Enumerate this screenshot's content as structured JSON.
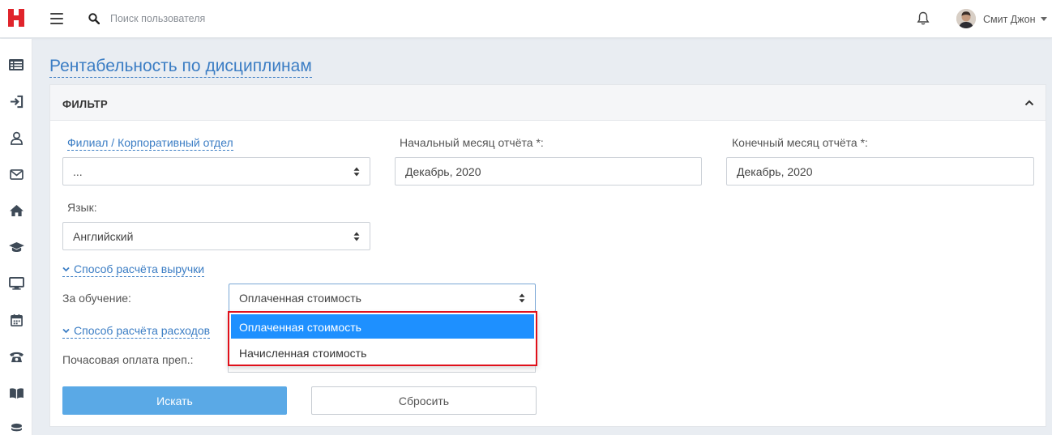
{
  "header": {
    "search_placeholder": "Поиск пользователя",
    "user_name": "Смит Джон"
  },
  "sidebar": {
    "items": [
      {
        "icon": "list-icon"
      },
      {
        "icon": "sign-in-icon"
      },
      {
        "icon": "user-icon"
      },
      {
        "icon": "envelope-icon"
      },
      {
        "icon": "home-icon"
      },
      {
        "icon": "graduation-cap-icon"
      },
      {
        "icon": "monitor-icon"
      },
      {
        "icon": "calendar-icon"
      },
      {
        "icon": "phone-icon"
      },
      {
        "icon": "book-icon"
      },
      {
        "icon": "coins-icon"
      }
    ]
  },
  "page": {
    "title": "Рентабельность по дисциплинам"
  },
  "filter": {
    "title": "ФИЛЬТР",
    "branch_label": "Филиал / Корпоративный отдел",
    "branch_value": "...",
    "start_month_label": "Начальный месяц отчёта *:",
    "start_month_value": "Декабрь, 2020",
    "end_month_label": "Конечный месяц отчёта *:",
    "end_month_value": "Декабрь, 2020",
    "language_label": "Язык:",
    "language_value": "Английский",
    "revenue_section": "Способ расчёта выручки",
    "tuition_label": "За обучение:",
    "tuition_value": "Оплаченная стоимость",
    "tuition_options": [
      "Оплаченная стоимость",
      "Начисленная стоимость"
    ],
    "expense_section": "Способ расчёта расходов",
    "hourly_label": "Почасовая оплата преп.:",
    "search_button": "Искать",
    "reset_button": "Сбросить"
  },
  "colors": {
    "accent": "#3b7dc4",
    "primary_button": "#5aa9e6",
    "selected_option": "#1e90ff",
    "highlight_border": "#e0101a",
    "logo": "#e0242b"
  }
}
